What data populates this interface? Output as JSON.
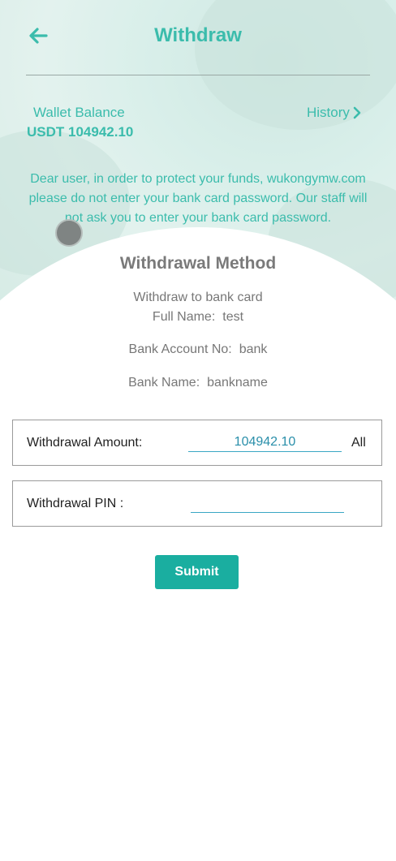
{
  "header": {
    "title": "Withdraw",
    "back_icon": "arrow-left-icon"
  },
  "wallet": {
    "label": "Wallet Balance",
    "value": "USDT 104942.10"
  },
  "history": {
    "label": "History",
    "icon": "chevron-right-icon"
  },
  "notice": "Dear user, in order to protect your funds, wukongymw.com please do not enter your bank card password. Our staff will not ask you to enter your bank card password.",
  "method": {
    "title": "Withdrawal Method",
    "type": "Withdraw to bank card",
    "full_name_label": "Full Name:",
    "full_name_value": "test",
    "account_label": "Bank Account No:",
    "account_value": "bank",
    "bank_name_label": "Bank Name:",
    "bank_name_value": "bankname"
  },
  "amount": {
    "label": "Withdrawal Amount:",
    "value": "104942.10",
    "all_label": "All"
  },
  "pin": {
    "label": "Withdrawal PIN :",
    "value": ""
  },
  "submit_label": "Submit",
  "colors": {
    "accent": "#3bbcac",
    "button": "#1aaea0"
  }
}
